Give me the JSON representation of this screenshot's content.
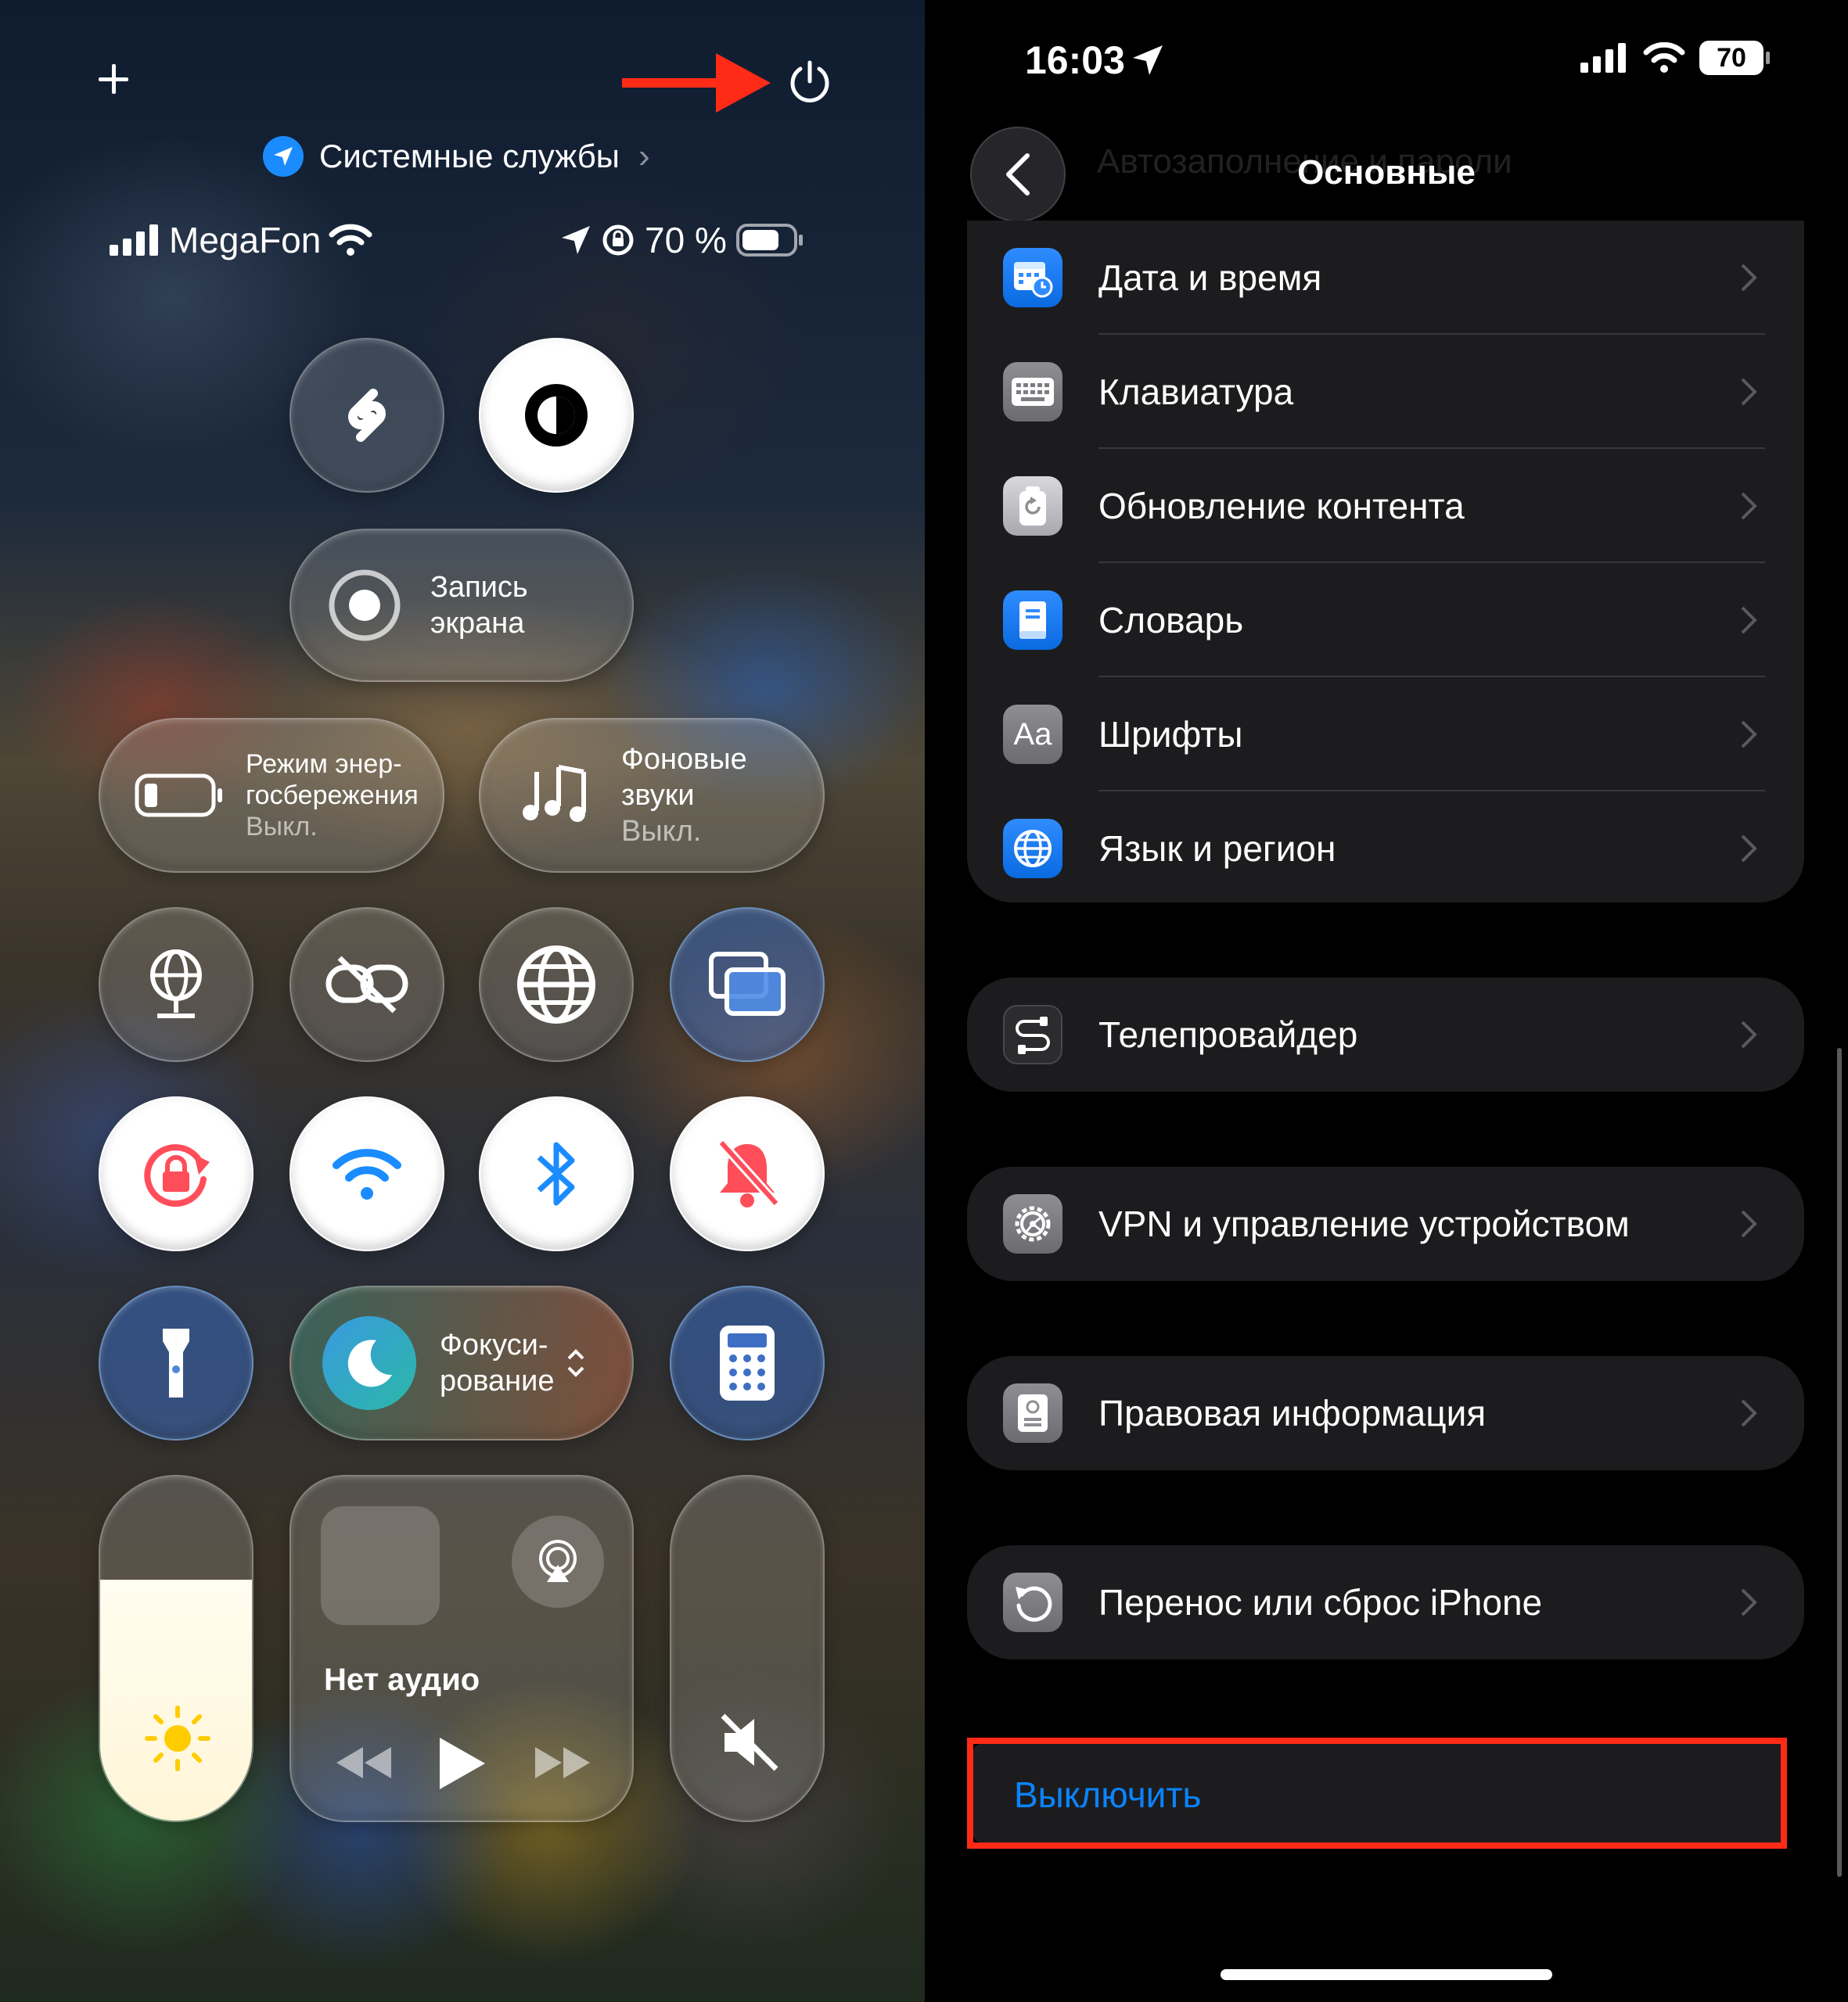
{
  "control_center": {
    "system_services_label": "Системные службы",
    "carrier": "MegaFon",
    "battery_percent_text": "70 %",
    "screen_recording_label_line1": "Запись",
    "screen_recording_label_line2": "экрана",
    "low_power": {
      "line1": "Режим энер-",
      "line2": "госбережения",
      "state": "Выкл."
    },
    "bg_sounds": {
      "line1": "Фоновые",
      "line2": "звуки",
      "state": "Выкл."
    },
    "focus": {
      "line1": "Фокуси-",
      "line2": "рование"
    },
    "media": {
      "no_audio": "Нет аудио"
    },
    "brightness_level": 0.7
  },
  "settings": {
    "status_time": "16:03",
    "battery_badge": "70",
    "nav_title": "Основные",
    "ghost_row_text": "Автозаполнение и пароли",
    "group1": [
      {
        "label": "Дата и время",
        "icon": "calendar-clock-icon"
      },
      {
        "label": "Клавиатура",
        "icon": "keyboard-icon"
      },
      {
        "label": "Обновление контента",
        "icon": "refresh-icon"
      },
      {
        "label": "Словарь",
        "icon": "book-icon"
      },
      {
        "label": "Шрифты",
        "icon": "font-icon",
        "icon_text": "Aa"
      },
      {
        "label": "Язык и регион",
        "icon": "globe-icon"
      }
    ],
    "tv_provider": "Телепровайдер",
    "vpn": "VPN и управление устройством",
    "legal": "Правовая информация",
    "transfer_reset": "Перенос или сброс iPhone",
    "shutdown": "Выключить"
  },
  "colors": {
    "accent_blue": "#0a84ff",
    "highlight_red": "#ff2b17",
    "group_bg": "#1c1c1e"
  }
}
